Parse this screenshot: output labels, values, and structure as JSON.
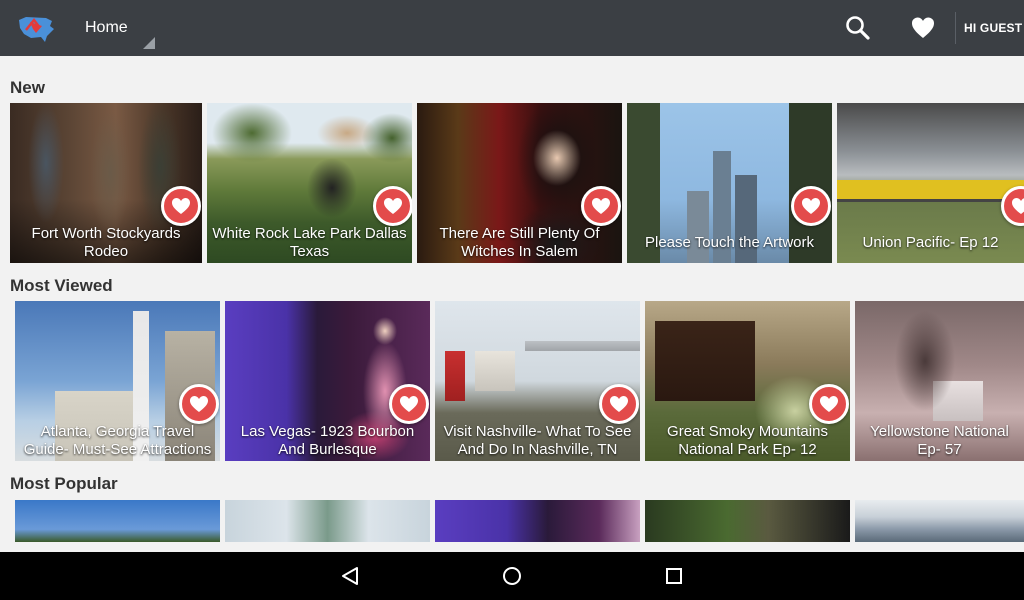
{
  "app": {
    "section": "Home",
    "greeting": "HI GUEST"
  },
  "sections": [
    {
      "title": "New",
      "items": [
        {
          "caption": "Fort Worth Stockyards Rodeo"
        },
        {
          "caption": "White Rock Lake Park Dallas Texas"
        },
        {
          "caption": "There Are Still Plenty Of Witches In Salem"
        },
        {
          "caption": "Please Touch the Artwork"
        },
        {
          "caption": "Union Pacific- Ep 12"
        }
      ]
    },
    {
      "title": "Most Viewed",
      "items": [
        {
          "caption": "Atlanta, Georgia Travel Guide- Must-See Attractions"
        },
        {
          "caption": "Las Vegas- 1923 Bourbon And Burlesque"
        },
        {
          "caption": "Visit Nashville- What To See And Do In Nashville, TN"
        },
        {
          "caption": "Great Smoky Mountains National Park Ep- 12"
        },
        {
          "caption": "Yellowstone National Ep- 57"
        }
      ]
    },
    {
      "title": "Most Popular",
      "items": []
    }
  ],
  "colors": {
    "topbar": "#3b3f44",
    "favorite": "#e34b4b",
    "background": "#f2f2f2"
  },
  "icons": {
    "logo": "usa-map-logo-icon",
    "search": "search-icon",
    "favorites": "heart-icon",
    "back": "back-icon",
    "home": "home-icon",
    "recents": "recents-icon"
  }
}
